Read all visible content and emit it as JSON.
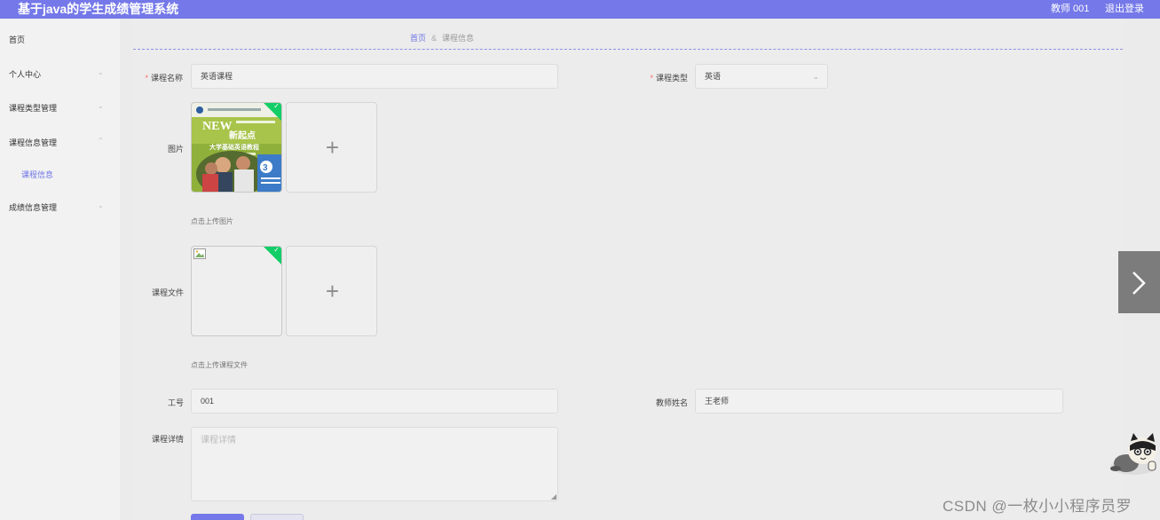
{
  "app": {
    "title": "基于java的学生成绩管理系统",
    "user": "教师 001",
    "logout": "退出登录"
  },
  "sidebar": {
    "items": [
      {
        "label": "首页"
      },
      {
        "label": "个人中心",
        "chevron": "⌄"
      },
      {
        "label": "课程类型管理",
        "chevron": "⌄"
      },
      {
        "label": "课程信息管理",
        "chevron": "⌃"
      },
      {
        "label": "课程信息"
      },
      {
        "label": "成绩信息管理",
        "chevron": "⌄"
      }
    ]
  },
  "breadcrumb": {
    "home": "首页",
    "separator": "&",
    "current": "课程信息"
  },
  "form": {
    "course_name": {
      "label": "课程名称",
      "value": "英语课程"
    },
    "course_type": {
      "label": "课程类型",
      "value": "英语"
    },
    "image": {
      "label": "图片",
      "hint": "点击上传图片"
    },
    "course_file": {
      "label": "课程文件",
      "hint": "点击上传课程文件"
    },
    "job_no": {
      "label": "工号",
      "value": "001"
    },
    "teacher_name": {
      "label": "教师姓名",
      "value": "王老师"
    },
    "details": {
      "label": "课程详情",
      "placeholder": "课程详情"
    }
  },
  "cover_image": {
    "brand": "NEW",
    "title_cn": "新起点",
    "subtitle_cn": "大学基础英语教程",
    "number": "3"
  },
  "watermark": "CSDN @一枚小小程序员罗",
  "colors": {
    "accent": "#7478e8",
    "success": "#13ce66",
    "danger": "#f56c6c"
  },
  "icons": {
    "upload": "plus-icon",
    "select": "chevron-down-icon",
    "next": "chevron-right-icon"
  }
}
